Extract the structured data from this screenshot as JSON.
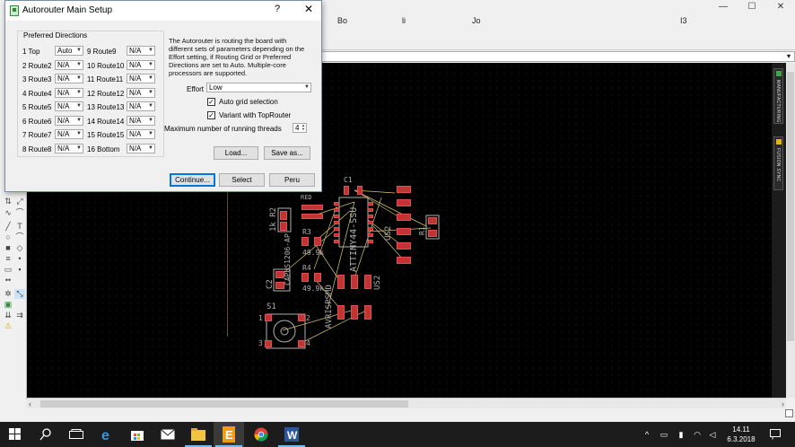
{
  "main_window": {
    "controls": {
      "minimize": "—",
      "maximize": "☐",
      "close": "✕"
    },
    "menu_fragments": [
      "Bo",
      "li",
      "Jo",
      "I3"
    ],
    "right_panel": {
      "manufacturing": "MANUFACTURING",
      "fusion_sync": "FUSION SYNC"
    }
  },
  "dialog": {
    "title": "Autorouter Main Setup",
    "help": "?",
    "close": "✕",
    "group_label": "Preferred Directions",
    "directions_left": [
      {
        "label": "1 Top",
        "value": "Auto"
      },
      {
        "label": "2 Route2",
        "value": "N/A"
      },
      {
        "label": "3 Route3",
        "value": "N/A"
      },
      {
        "label": "4 Route4",
        "value": "N/A"
      },
      {
        "label": "5 Route5",
        "value": "N/A"
      },
      {
        "label": "6 Route6",
        "value": "N/A"
      },
      {
        "label": "7 Route7",
        "value": "N/A"
      },
      {
        "label": "8 Route8",
        "value": "N/A"
      }
    ],
    "directions_right": [
      {
        "label": "9 Route9",
        "value": "N/A"
      },
      {
        "label": "10 Route10",
        "value": "N/A"
      },
      {
        "label": "11 Route11",
        "value": "N/A"
      },
      {
        "label": "12 Route12",
        "value": "N/A"
      },
      {
        "label": "13 Route13",
        "value": "N/A"
      },
      {
        "label": "14 Route14",
        "value": "N/A"
      },
      {
        "label": "15 Route15",
        "value": "N/A"
      },
      {
        "label": "16 Bottom",
        "value": "N/A"
      }
    ],
    "description": "The Autorouter is routing the board with different sets of parameters depending on the Effort setting, if Routing Grid or Preferred Directions are set to Auto. Multiple-core processors are supported.",
    "effort_label": "Effort",
    "effort_value": "Low",
    "auto_grid_label": "Auto grid selection",
    "auto_grid_checked": true,
    "variant_label": "Variant with TopRouter",
    "variant_checked": true,
    "threads_label": "Maximum number of running threads",
    "threads_value": "4",
    "load_button": "Load...",
    "save_button": "Save as...",
    "continue_button": "Continue...",
    "select_button": "Select",
    "peru_button": "Peru",
    "check_mark": "✓"
  },
  "pcb": {
    "labels": {
      "c1": "C1",
      "red": "RED",
      "r2": "1k R2",
      "r3": "R3",
      "r3_value": "49.9k",
      "r4": "R4",
      "r4_value": "49.9k",
      "capus": "CAPUS1206-AP",
      "c2": "C2",
      "s1": "S1",
      "s1_pins": [
        "1",
        "2",
        "3",
        "4"
      ],
      "attiny": "ATTINY44-SSU",
      "us2_a": "US2",
      "us2_b": "US2",
      "r1": "R1",
      "avrispsmd": "AVRISPSMD"
    }
  },
  "taskbar": {
    "clock_time": "14.11",
    "clock_date": "6.3.2018",
    "apps": [
      "search",
      "task-view",
      "edge",
      "store",
      "mail",
      "file-explorer",
      "eagle",
      "chrome",
      "word"
    ]
  },
  "colors": {
    "pad": "#c03434",
    "silkscreen": "#b0b0b0",
    "airwire": "#d8c66a",
    "canvas": "#000000",
    "taskbar": "#1c1c1c"
  }
}
